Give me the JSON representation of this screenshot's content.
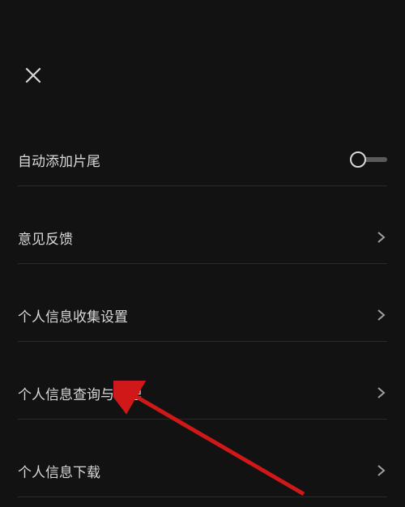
{
  "settings": {
    "items": [
      {
        "label": "自动添加片尾",
        "type": "toggle",
        "value": false
      },
      {
        "label": "意见反馈",
        "type": "nav"
      },
      {
        "label": "个人信息收集设置",
        "type": "nav"
      },
      {
        "label": "个人信息查询与管理",
        "type": "nav"
      },
      {
        "label": "个人信息下载",
        "type": "nav"
      }
    ]
  }
}
